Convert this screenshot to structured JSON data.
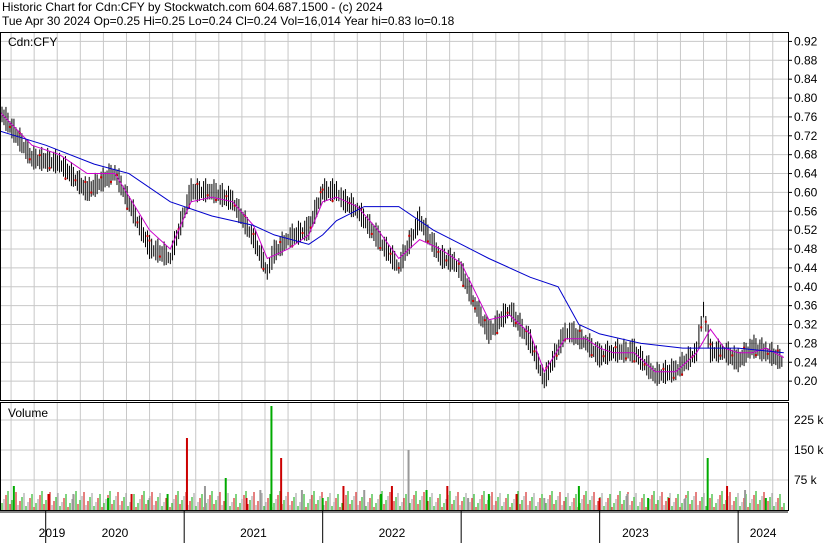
{
  "header": {
    "line1": "Historic Chart for Cdn:CFY by Stockwatch.com 604.687.1500 - (c) 2024",
    "line2": "Tue Apr 30 2024  Op=0.25  Hi=0.25  Lo=0.24  Cl=0.24  Vol=16,014  Year hi=0.83  lo=0.18"
  },
  "colors": {
    "price_bar": "#000000",
    "ma_short": "#cc00cc",
    "ma_long": "#0000cc",
    "up_vol": "#00aa00",
    "down_vol": "#cc0000",
    "flat_vol": "#999999",
    "grid": "#c8c8c8"
  },
  "chart_data": [
    {
      "type": "line",
      "panel": "price",
      "title": "Cdn:CFY",
      "x_labels": [
        "2019",
        "2020",
        "2021",
        "2022",
        "2023",
        "2024"
      ],
      "ylim": [
        0.16,
        0.94
      ],
      "y_ticks": [
        "0.20",
        "0.24",
        "0.28",
        "0.32",
        "0.36",
        "0.40",
        "0.44",
        "0.48",
        "0.52",
        "0.56",
        "0.60",
        "0.64",
        "0.68",
        "0.72",
        "0.76",
        "0.80",
        "0.84",
        "0.88",
        "0.92"
      ],
      "grid": true,
      "series": [
        {
          "key": "close",
          "x": [
            2018.67,
            2018.9,
            2019.1,
            2019.3,
            2019.5,
            2019.75,
            2019.9,
            2020.05,
            2020.2,
            2020.35,
            2020.5,
            2020.6,
            2020.65,
            2020.75,
            2020.9,
            2021.0,
            2021.1,
            2021.15,
            2021.25,
            2021.4,
            2021.55,
            2021.7,
            2021.85,
            2021.95,
            2022.0,
            2022.1,
            2022.2,
            2022.35,
            2022.5,
            2022.6,
            2022.75,
            2022.8,
            2022.9,
            2023.0,
            2023.1,
            2023.25,
            2023.4,
            2023.55,
            2023.7,
            2023.75,
            2023.8,
            2023.9,
            2024.0,
            2024.1,
            2024.2,
            2024.33
          ],
          "y": [
            0.77,
            0.67,
            0.66,
            0.6,
            0.64,
            0.48,
            0.46,
            0.6,
            0.6,
            0.58,
            0.5,
            0.43,
            0.47,
            0.5,
            0.52,
            0.6,
            0.6,
            0.58,
            0.56,
            0.5,
            0.44,
            0.54,
            0.46,
            0.45,
            0.43,
            0.36,
            0.3,
            0.35,
            0.28,
            0.2,
            0.3,
            0.3,
            0.28,
            0.25,
            0.26,
            0.26,
            0.21,
            0.22,
            0.26,
            0.35,
            0.26,
            0.26,
            0.24,
            0.27,
            0.26,
            0.24
          ]
        },
        {
          "key": "ma_short",
          "x": [
            2018.67,
            2018.9,
            2019.1,
            2019.3,
            2019.5,
            2019.75,
            2019.9,
            2020.05,
            2020.2,
            2020.35,
            2020.5,
            2020.6,
            2020.75,
            2020.9,
            2021.0,
            2021.1,
            2021.25,
            2021.4,
            2021.55,
            2021.7,
            2021.85,
            2022.0,
            2022.1,
            2022.2,
            2022.35,
            2022.5,
            2022.6,
            2022.75,
            2022.9,
            2023.0,
            2023.1,
            2023.25,
            2023.4,
            2023.55,
            2023.7,
            2023.8,
            2023.9,
            2024.0,
            2024.1,
            2024.2,
            2024.33
          ],
          "y": [
            0.77,
            0.7,
            0.68,
            0.64,
            0.64,
            0.52,
            0.48,
            0.58,
            0.59,
            0.58,
            0.53,
            0.46,
            0.48,
            0.51,
            0.58,
            0.59,
            0.57,
            0.52,
            0.46,
            0.5,
            0.48,
            0.45,
            0.39,
            0.33,
            0.34,
            0.3,
            0.22,
            0.29,
            0.29,
            0.27,
            0.26,
            0.26,
            0.22,
            0.22,
            0.26,
            0.31,
            0.27,
            0.26,
            0.26,
            0.27,
            0.25
          ]
        },
        {
          "key": "ma_long",
          "x": [
            2018.67,
            2019.0,
            2019.35,
            2019.6,
            2019.9,
            2020.2,
            2020.5,
            2020.65,
            2020.9,
            2021.0,
            2021.1,
            2021.3,
            2021.55,
            2021.8,
            2022.0,
            2022.2,
            2022.5,
            2022.7,
            2022.85,
            2023.0,
            2023.3,
            2023.6,
            2023.8,
            2024.0,
            2024.33
          ],
          "y": [
            0.73,
            0.7,
            0.66,
            0.64,
            0.58,
            0.55,
            0.53,
            0.51,
            0.49,
            0.51,
            0.54,
            0.57,
            0.57,
            0.52,
            0.49,
            0.46,
            0.42,
            0.4,
            0.32,
            0.3,
            0.28,
            0.27,
            0.27,
            0.27,
            0.26
          ]
        }
      ]
    },
    {
      "type": "bar",
      "panel": "volume",
      "title": "Volume",
      "ylim": [
        0,
        270000
      ],
      "y_ticks": [
        "75 k",
        "150 k",
        "225 k"
      ],
      "grid": true,
      "series": [
        {
          "name": "volume",
          "x": [
            2018.77,
            2019.02,
            2019.2,
            2019.45,
            2019.62,
            2019.75,
            2019.88,
            2020.02,
            2020.15,
            2020.3,
            2020.45,
            2020.55,
            2020.63,
            2020.7,
            2020.85,
            2021.0,
            2021.15,
            2021.3,
            2021.42,
            2021.5,
            2021.62,
            2021.75,
            2021.9,
            2022.05,
            2022.2,
            2022.4,
            2022.6,
            2022.85,
            2023.0,
            2023.2,
            2023.35,
            2023.5,
            2023.62,
            2023.78,
            2023.92,
            2024.05,
            2024.2
          ],
          "y": [
            60000,
            40000,
            40000,
            30000,
            40000,
            30000,
            40000,
            180000,
            60000,
            80000,
            30000,
            50000,
            260000,
            130000,
            50000,
            30000,
            60000,
            50000,
            40000,
            60000,
            150000,
            50000,
            60000,
            30000,
            40000,
            40000,
            30000,
            60000,
            30000,
            40000,
            30000,
            30000,
            30000,
            130000,
            60000,
            50000,
            30000
          ]
        }
      ]
    }
  ]
}
